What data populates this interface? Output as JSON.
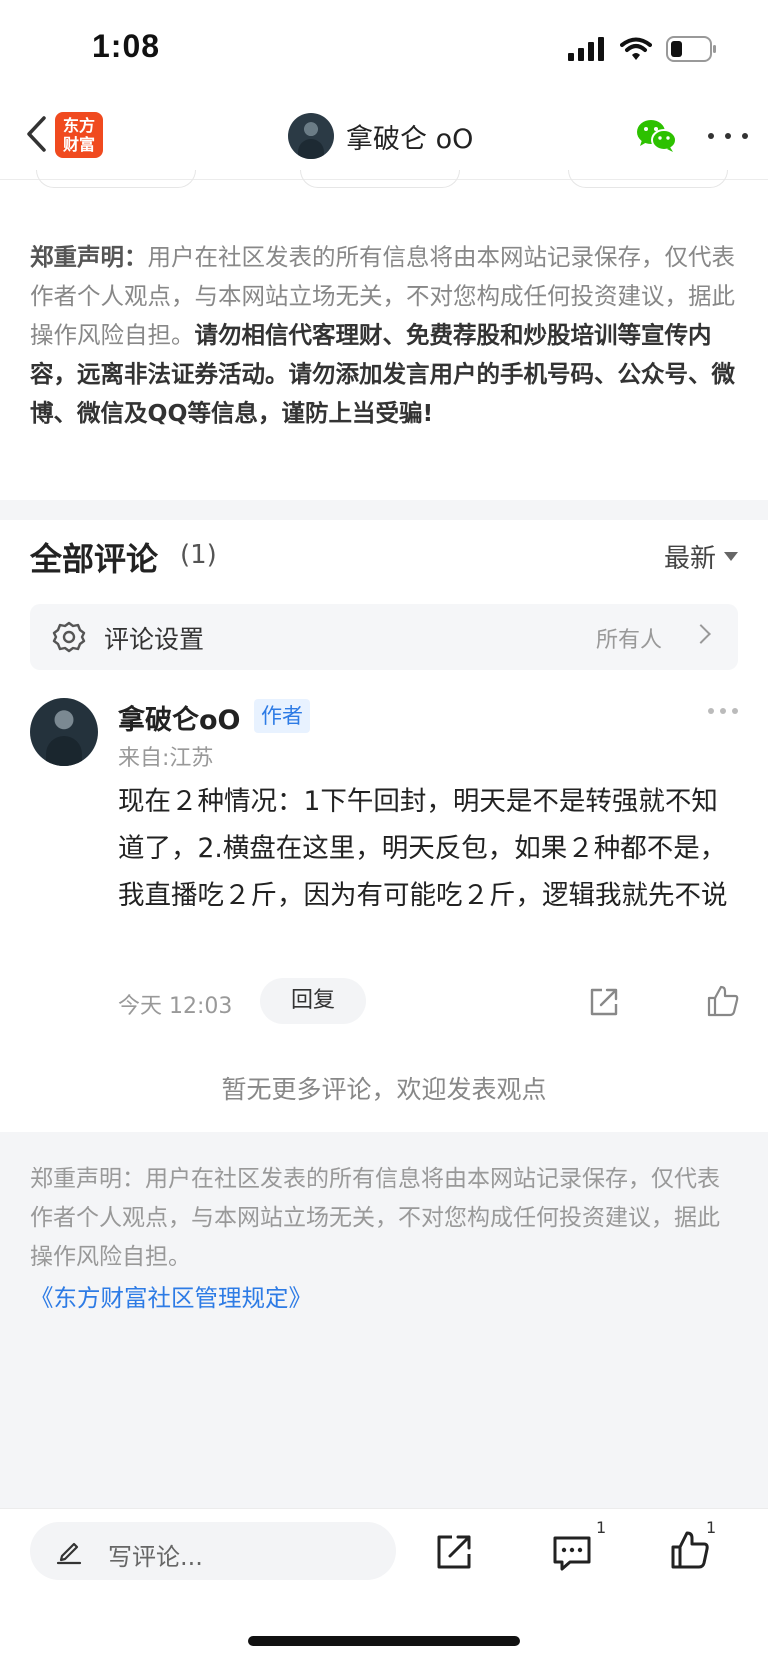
{
  "status_bar": {
    "time": "1:08"
  },
  "nav": {
    "logo_line1": "东方",
    "logo_line2": "财富",
    "title": "拿破仑 oO"
  },
  "disclaimer_top": {
    "lead": "郑重声明：",
    "normal": "用户在社区发表的所有信息将由本网站记录保存，仅代表作者个人观点，与本网站立场无关，不对您构成任何投资建议，据此操作风险自担。",
    "strong": "请勿相信代客理财、免费荐股和炒股培训等宣传内容，远离非法证券活动。请勿添加发言用户的手机号码、公众号、微博、微信及QQ等信息，谨防上当受骗!"
  },
  "comments": {
    "title": "全部评论",
    "count": "(1)",
    "sort_label": "最新",
    "settings_label": "评论设置",
    "settings_value": "所有人",
    "items": [
      {
        "user": "拿破仑oO",
        "badge": "作者",
        "location": "来自:江苏",
        "body": "现在２种情况：1下午回封，明天是不是转强就不知道了，2.横盘在这里，明天反包，如果２种都不是，我直播吃２斤，因为有可能吃２斤，逻辑我就先不说",
        "time": "今天 12:03",
        "reply_label": "回复"
      }
    ],
    "no_more": "暂无更多评论，欢迎发表观点"
  },
  "footer": {
    "disclaimer": "郑重声明：用户在社区发表的所有信息将由本网站记录保存，仅代表作者个人观点，与本网站立场无关，不对您构成任何投资建议，据此操作风险自担。",
    "rules_link": "《东方财富社区管理规定》"
  },
  "bottom_bar": {
    "input_placeholder": "写评论...",
    "comment_count": "1",
    "like_count": "1"
  },
  "colors": {
    "brand": "#f04a1f",
    "link": "#2d7be5",
    "wechat": "#2dc100"
  },
  "icons": [
    "back-icon",
    "wechat-icon",
    "more-icon",
    "gear-icon",
    "chevron-right-icon",
    "share-icon",
    "thumbs-up-icon",
    "pencil-icon",
    "comment-icon"
  ]
}
